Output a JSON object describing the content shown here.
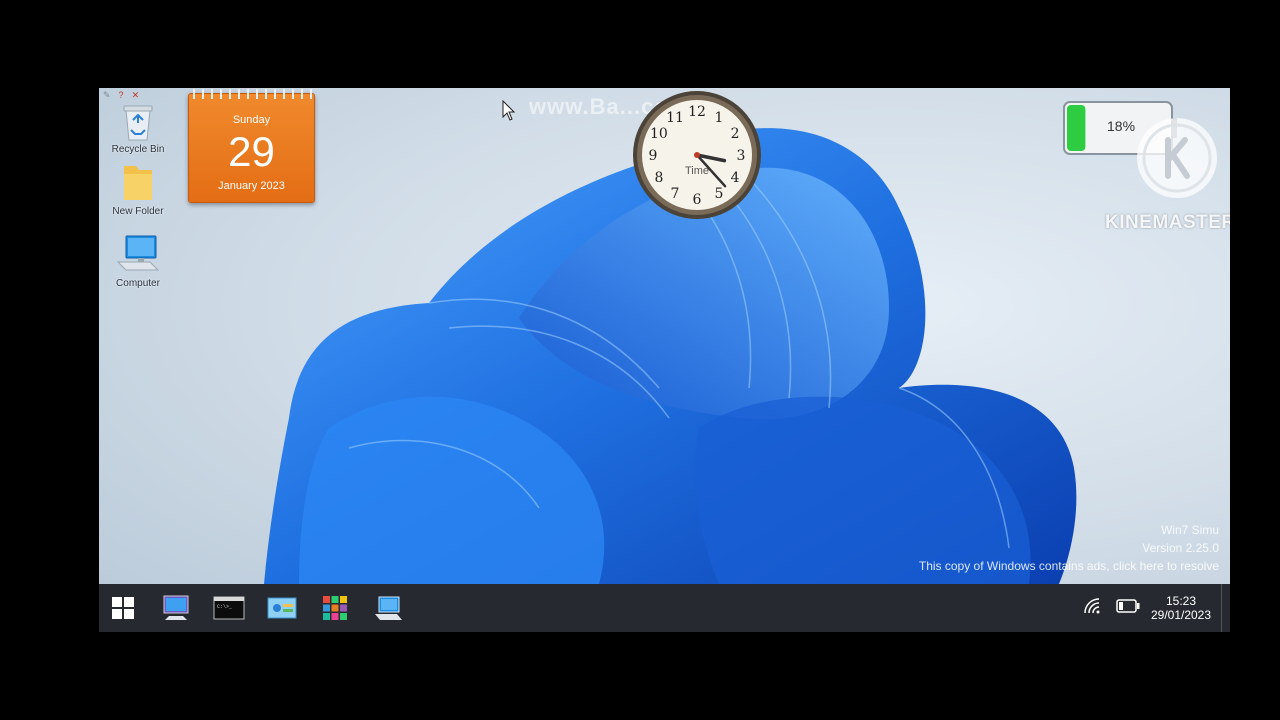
{
  "desktop": {
    "icons": [
      {
        "label": "Recycle Bin",
        "icon": "recycle-bin-icon"
      },
      {
        "label": "New Folder",
        "icon": "folder-icon"
      },
      {
        "label": "Computer",
        "icon": "computer-icon"
      }
    ]
  },
  "calendar": {
    "weekday": "Sunday",
    "day": "29",
    "month_year": "January 2023"
  },
  "clock_gadget": {
    "label": "Time",
    "numerals": [
      "12",
      "1",
      "2",
      "3",
      "4",
      "5",
      "6",
      "7",
      "8",
      "9",
      "10",
      "11"
    ],
    "hour": 3,
    "minute": 23
  },
  "watermark": {
    "text": "www.Ba...com"
  },
  "battery_gadget": {
    "percent_label": "18%",
    "level": 0.18,
    "fill_color": "#2ecc40"
  },
  "kinemaster": {
    "text": "KINEMASTER"
  },
  "activation": {
    "line1": "Win7 Simu",
    "line2": "Version 2.25.0",
    "line3": "This copy of Windows contains ads, click here to resolve"
  },
  "taskbar": {
    "buttons": [
      {
        "icon": "windows-start-icon"
      },
      {
        "icon": "desktop-computer-icon"
      },
      {
        "icon": "command-prompt-icon"
      },
      {
        "icon": "control-panel-icon"
      },
      {
        "icon": "apps-grid-icon"
      },
      {
        "icon": "laptop-icon"
      }
    ],
    "tray": {
      "time": "15:23",
      "date": "29/01/2023"
    }
  },
  "colors": {
    "accent_blue": "#1f6fe0",
    "taskbar": "#262a30",
    "calendar_orange": "#e46d14"
  }
}
